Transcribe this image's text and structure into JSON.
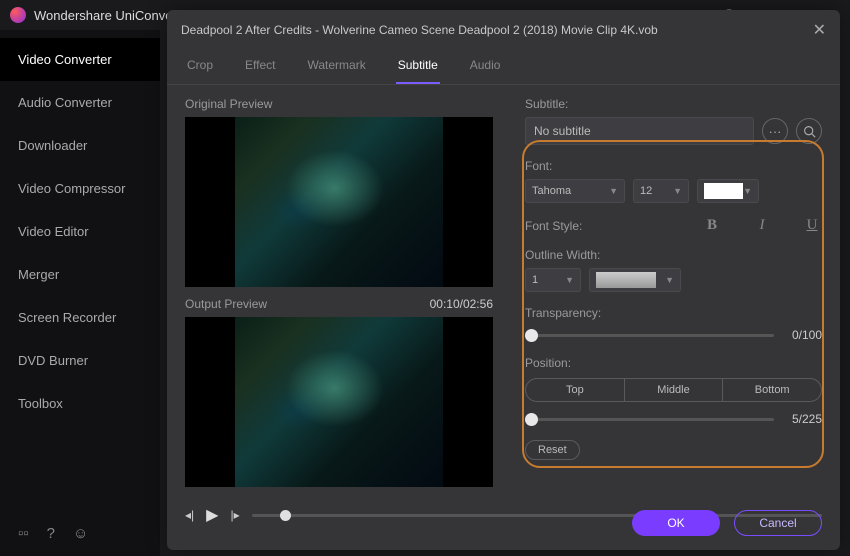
{
  "app": {
    "name": "Wondershare UniConverter"
  },
  "sidebar": {
    "items": [
      {
        "label": "Video Converter"
      },
      {
        "label": "Audio Converter"
      },
      {
        "label": "Downloader"
      },
      {
        "label": "Video Compressor"
      },
      {
        "label": "Video Editor"
      },
      {
        "label": "Merger"
      },
      {
        "label": "Screen Recorder"
      },
      {
        "label": "DVD Burner"
      },
      {
        "label": "Toolbox"
      }
    ]
  },
  "dialog": {
    "title": "Deadpool 2 After Credits - Wolverine Cameo Scene  Deadpool 2 (2018) Movie Clip 4K.vob",
    "tabs": [
      {
        "label": "Crop"
      },
      {
        "label": "Effect"
      },
      {
        "label": "Watermark"
      },
      {
        "label": "Subtitle"
      },
      {
        "label": "Audio"
      }
    ],
    "original_label": "Original Preview",
    "output_label": "Output Preview",
    "timecode": "00:10/02:56",
    "ok": "OK",
    "cancel": "Cancel"
  },
  "sub": {
    "label": "Subtitle:",
    "value": "No subtitle",
    "dots": "···",
    "font_label": "Font:",
    "font_name": "Tahoma",
    "font_size": "12",
    "font_style_label": "Font Style:",
    "outline_label": "Outline Width:",
    "outline_value": "1",
    "transparency_label": "Transparency:",
    "transparency_value": "0/100",
    "position_label": "Position:",
    "pos_top": "Top",
    "pos_middle": "Middle",
    "pos_bottom": "Bottom",
    "position_value": "5/225",
    "reset": "Reset"
  }
}
